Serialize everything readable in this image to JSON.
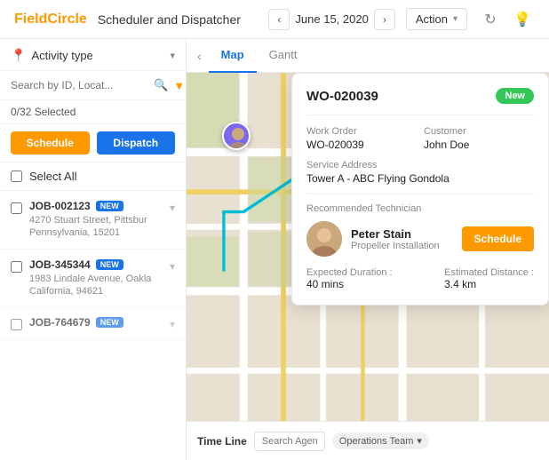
{
  "header": {
    "logo_prefix": "Field",
    "logo_suffix": "Circle",
    "title": "Scheduler and Dispatcher",
    "date": "June 15, 2020",
    "action_label": "Action",
    "nav_prev": "‹",
    "nav_next": "›"
  },
  "left_panel": {
    "activity_type_label": "Activity type",
    "search_placeholder": "Search by ID, Locat...",
    "selected_count": "0/32 Selected",
    "schedule_btn": "Schedule",
    "dispatch_btn": "Dispatch",
    "select_all_label": "Select All",
    "jobs": [
      {
        "id": "JOB-002123",
        "badge": "NEW",
        "address_line1": "4270 Stuart Street, Pittsbur",
        "address_line2": "Pennsylvania, 15201"
      },
      {
        "id": "JOB-345344",
        "badge": "NEW",
        "address_line1": "1983 Lindale Avenue, Oakla",
        "address_line2": "California, 94621"
      },
      {
        "id": "JOB-764679",
        "badge": "NEW",
        "address_line1": "",
        "address_line2": ""
      }
    ]
  },
  "tabs": {
    "map_label": "Map",
    "gantt_label": "Gantt"
  },
  "timeline": {
    "label": "Time Line",
    "search_agent_placeholder": "Search Agent",
    "ops_team": "Operations Team"
  },
  "popup": {
    "wo_id": "WO-020039",
    "status_badge": "New",
    "work_order_label": "Work Order",
    "work_order_value": "WO-020039",
    "customer_label": "Customer",
    "customer_value": "John Doe",
    "service_address_label": "Service Address",
    "service_address_value": "Tower A - ABC Flying Gondola",
    "recommended_label": "Recommended Technician",
    "tech_name": "Peter Stain",
    "tech_role": "Propeller Installation",
    "schedule_btn": "Schedule",
    "expected_duration_label": "Expected Duration :",
    "expected_duration_value": "40 mins",
    "estimated_distance_label": "Estimated Distance :",
    "estimated_distance_value": "3.4 km"
  },
  "colors": {
    "orange": "#f90",
    "blue": "#1a73e8",
    "green": "#34c759",
    "header_bg": "#ffffff"
  }
}
